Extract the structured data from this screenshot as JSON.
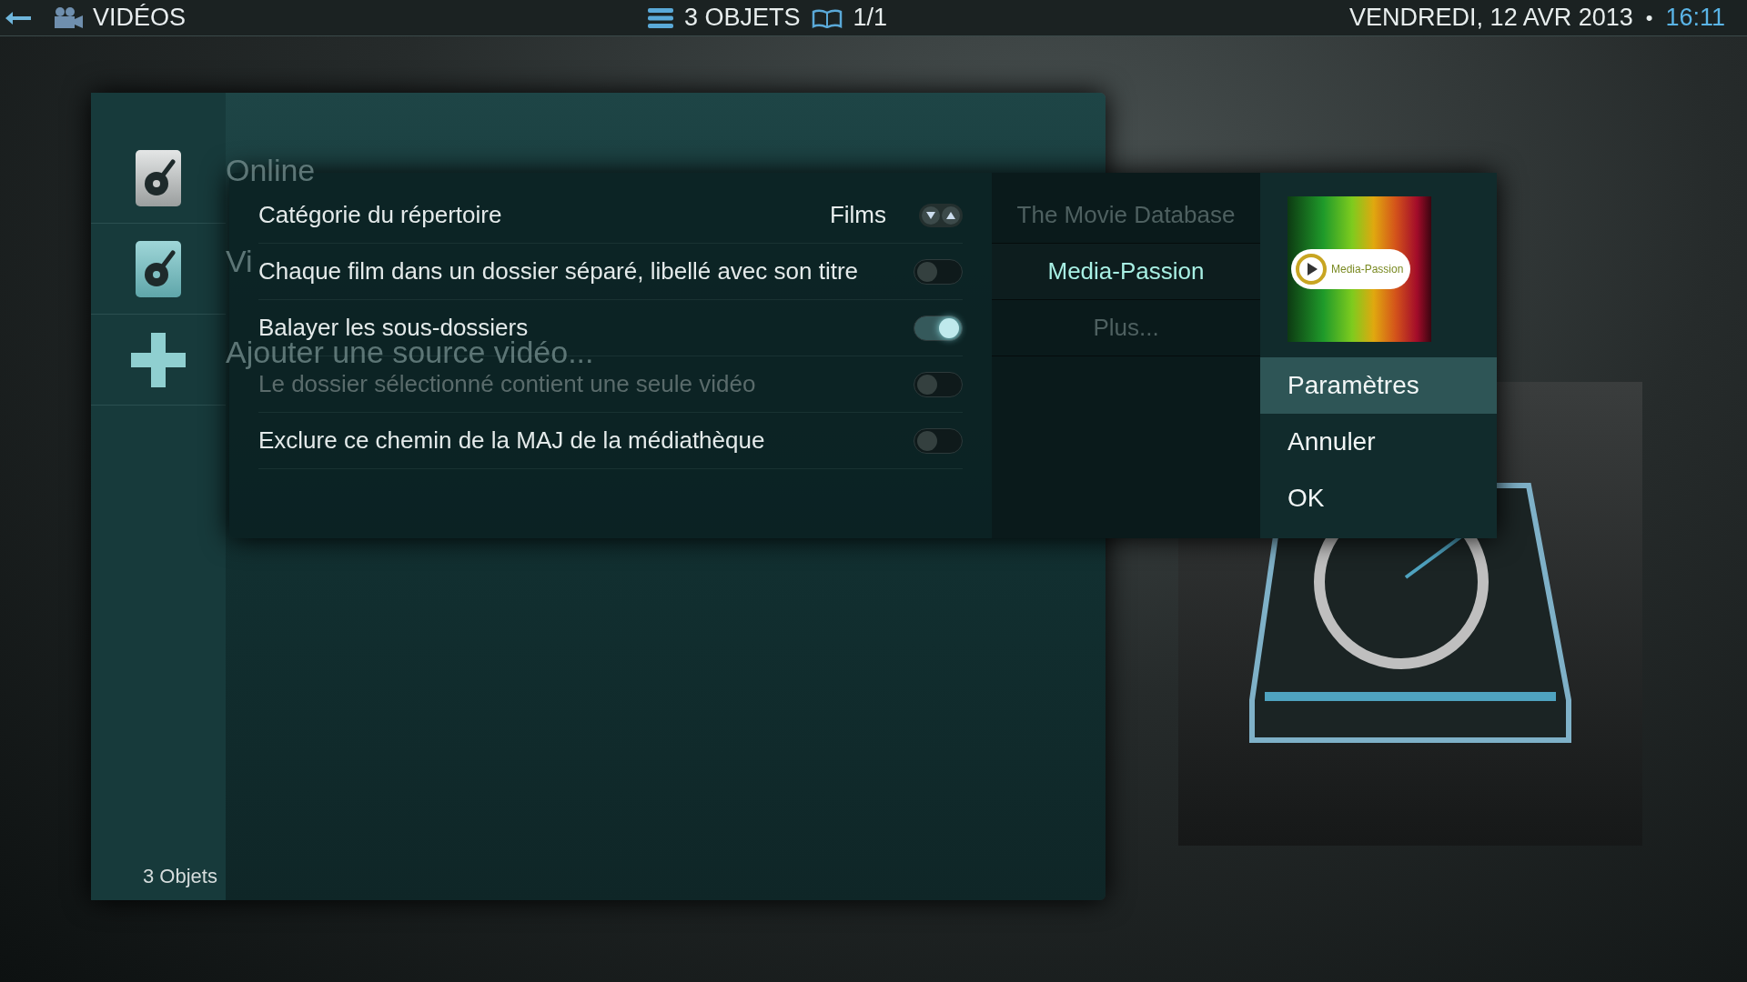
{
  "top_bar": {
    "section": "VIDÉOS",
    "item_count": "3 OBJETS",
    "page": "1/1",
    "date": "VENDREDI, 12 AVR 2013",
    "separator": "•",
    "time": "16:11"
  },
  "sources": {
    "items": [
      {
        "label": "Online",
        "kind": "disk"
      },
      {
        "label": "Vi",
        "kind": "disk"
      },
      {
        "label": "Ajouter une source vidéo...",
        "kind": "add"
      }
    ],
    "footer": "3 Objets"
  },
  "dialog": {
    "settings": [
      {
        "kind": "spinner",
        "label": "Catégorie du répertoire",
        "value": "Films",
        "disabled": false
      },
      {
        "kind": "toggle",
        "label": "Chaque film dans un dossier séparé, libellé avec son titre",
        "on": false,
        "disabled": false
      },
      {
        "kind": "toggle",
        "label": "Balayer les sous-dossiers",
        "on": true,
        "disabled": false
      },
      {
        "kind": "toggle",
        "label": "Le dossier sélectionné contient une seule vidéo",
        "on": false,
        "disabled": true
      },
      {
        "kind": "toggle",
        "label": "Exclure ce chemin de la MAJ de la médiathèque",
        "on": false,
        "disabled": false
      }
    ],
    "scrapers": [
      {
        "label": "The Movie Database",
        "selected": false
      },
      {
        "label": "Media-Passion",
        "selected": true
      },
      {
        "label": "Plus...",
        "selected": false
      }
    ],
    "logo_text": "Media-Passion",
    "buttons": [
      {
        "label": "Paramètres",
        "selected": true
      },
      {
        "label": "Annuler",
        "selected": false
      },
      {
        "label": "OK",
        "selected": false
      }
    ]
  }
}
